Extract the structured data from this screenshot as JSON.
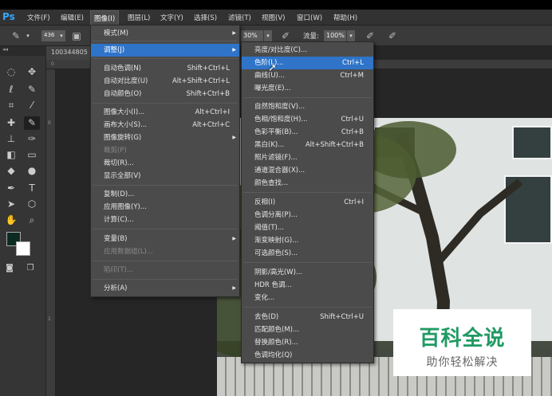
{
  "app": {
    "logo": "Ps"
  },
  "menubar": [
    {
      "label": "文件(F)"
    },
    {
      "label": "编辑(E)"
    },
    {
      "label": "图像(I)"
    },
    {
      "label": "图层(L)"
    },
    {
      "label": "文字(Y)"
    },
    {
      "label": "选择(S)"
    },
    {
      "label": "滤镜(T)"
    },
    {
      "label": "视图(V)"
    },
    {
      "label": "窗口(W)"
    },
    {
      "label": "帮助(H)"
    }
  ],
  "options": {
    "brush_size": "436",
    "opacity_value": "30%",
    "flow_label": "流量:",
    "flow_value": "100%"
  },
  "tools": {
    "collapse_glyph": "◂◂"
  },
  "document": {
    "tab_label": "100344805"
  },
  "rulers": {
    "top_zero": "0",
    "left_zero": "0",
    "left_one": "1"
  },
  "image_menu": {
    "items": [
      {
        "label": "模式(M)",
        "shortcut": "",
        "submenu": true,
        "disabled": false
      },
      {
        "label": "调整(J)",
        "shortcut": "",
        "submenu": true,
        "disabled": false,
        "highlighted": true
      },
      {
        "label": "自动色调(N)",
        "shortcut": "Shift+Ctrl+L"
      },
      {
        "label": "自动对比度(U)",
        "shortcut": "Alt+Shift+Ctrl+L"
      },
      {
        "label": "自动颜色(O)",
        "shortcut": "Shift+Ctrl+B"
      },
      {
        "label": "图像大小(I)...",
        "shortcut": "Alt+Ctrl+I"
      },
      {
        "label": "画布大小(S)...",
        "shortcut": "Alt+Ctrl+C"
      },
      {
        "label": "图像旋转(G)",
        "shortcut": "",
        "submenu": true
      },
      {
        "label": "裁剪(P)",
        "shortcut": "",
        "disabled": true
      },
      {
        "label": "裁切(R)...",
        "shortcut": ""
      },
      {
        "label": "显示全部(V)",
        "shortcut": ""
      },
      {
        "label": "复制(D)...",
        "shortcut": ""
      },
      {
        "label": "应用图像(Y)...",
        "shortcut": ""
      },
      {
        "label": "计算(C)...",
        "shortcut": ""
      },
      {
        "label": "变量(B)",
        "shortcut": "",
        "submenu": true
      },
      {
        "label": "应用数据组(L)...",
        "shortcut": "",
        "disabled": true
      },
      {
        "label": "陷印(T)...",
        "shortcut": "",
        "disabled": true
      },
      {
        "label": "分析(A)",
        "shortcut": "",
        "submenu": true
      }
    ]
  },
  "adjust_menu": {
    "items": [
      {
        "label": "亮度/对比度(C)...",
        "shortcut": ""
      },
      {
        "label": "色阶(L)...",
        "shortcut": "Ctrl+L",
        "highlighted": true
      },
      {
        "label": "曲线(U)...",
        "shortcut": "Ctrl+M"
      },
      {
        "label": "曝光度(E)...",
        "shortcut": ""
      },
      {
        "label": "自然饱和度(V)...",
        "shortcut": ""
      },
      {
        "label": "色相/饱和度(H)...",
        "shortcut": "Ctrl+U"
      },
      {
        "label": "色彩平衡(B)...",
        "shortcut": "Ctrl+B"
      },
      {
        "label": "黑白(K)...",
        "shortcut": "Alt+Shift+Ctrl+B"
      },
      {
        "label": "照片滤镜(F)...",
        "shortcut": ""
      },
      {
        "label": "通道混合器(X)...",
        "shortcut": ""
      },
      {
        "label": "颜色查找...",
        "shortcut": ""
      },
      {
        "label": "反相(I)",
        "shortcut": "Ctrl+I"
      },
      {
        "label": "色调分离(P)...",
        "shortcut": ""
      },
      {
        "label": "阈值(T)...",
        "shortcut": ""
      },
      {
        "label": "渐变映射(G)...",
        "shortcut": ""
      },
      {
        "label": "可选颜色(S)...",
        "shortcut": ""
      },
      {
        "label": "阴影/高光(W)...",
        "shortcut": ""
      },
      {
        "label": "HDR 色调...",
        "shortcut": ""
      },
      {
        "label": "变化...",
        "shortcut": ""
      },
      {
        "label": "去色(D)",
        "shortcut": "Shift+Ctrl+U"
      },
      {
        "label": "匹配颜色(M)...",
        "shortcut": ""
      },
      {
        "label": "替换颜色(R)...",
        "shortcut": ""
      },
      {
        "label": "色调均化(Q)",
        "shortcut": ""
      }
    ]
  },
  "watermark": {
    "title": "百科全说",
    "subtitle": "助你轻松解决"
  },
  "colors": {
    "highlight": "#2f74c8",
    "menu_bg": "#4b4b4b",
    "foreground_swatch": "#0c2b22",
    "background_swatch": "#ffffff",
    "watermark_green": "#1f9a63"
  }
}
